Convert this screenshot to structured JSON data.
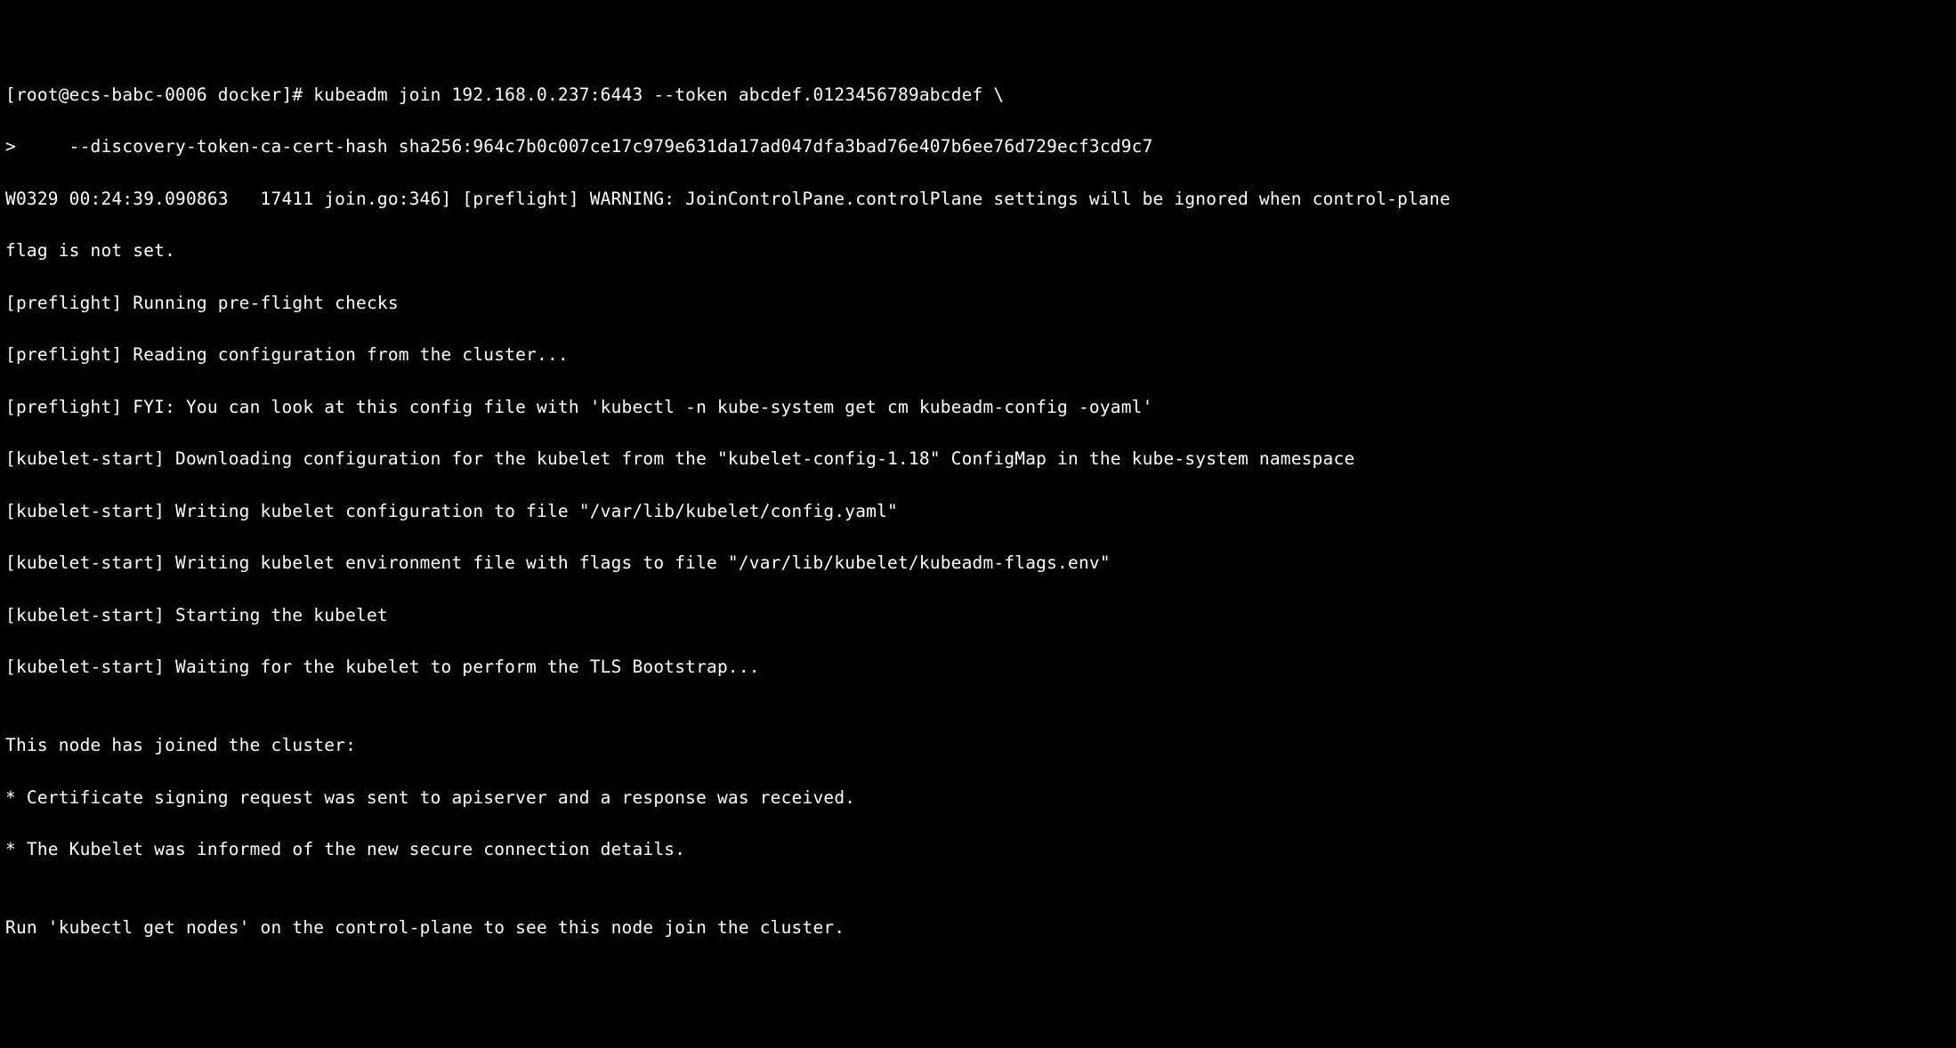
{
  "lines": [
    "[root@ecs-babc-0006 docker]# kubeadm join 192.168.0.237:6443 --token abcdef.0123456789abcdef \\",
    ">     --discovery-token-ca-cert-hash sha256:964c7b0c007ce17c979e631da17ad047dfa3bad76e407b6ee76d729ecf3cd9c7",
    "W0329 00:24:39.090863   17411 join.go:346] [preflight] WARNING: JoinControlPane.controlPlane settings will be ignored when control-plane",
    "flag is not set.",
    "[preflight] Running pre-flight checks",
    "[preflight] Reading configuration from the cluster...",
    "[preflight] FYI: You can look at this config file with 'kubectl -n kube-system get cm kubeadm-config -oyaml'",
    "[kubelet-start] Downloading configuration for the kubelet from the \"kubelet-config-1.18\" ConfigMap in the kube-system namespace",
    "[kubelet-start] Writing kubelet configuration to file \"/var/lib/kubelet/config.yaml\"",
    "[kubelet-start] Writing kubelet environment file with flags to file \"/var/lib/kubelet/kubeadm-flags.env\"",
    "[kubelet-start] Starting the kubelet",
    "[kubelet-start] Waiting for the kubelet to perform the TLS Bootstrap...",
    "",
    "This node has joined the cluster:",
    "* Certificate signing request was sent to apiserver and a response was received.",
    "* The Kubelet was informed of the new secure connection details.",
    "",
    "Run 'kubectl get nodes' on the control-plane to see this node join the cluster."
  ]
}
